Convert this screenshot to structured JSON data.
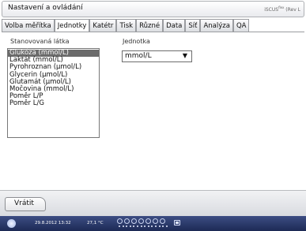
{
  "window": {
    "title": "Nastavení a ovládání",
    "brand": "iSCUS",
    "brand_sup": "flex",
    "brand_suffix": "(Rev L"
  },
  "tabs": [
    {
      "label": "Volba měřítka",
      "active": false
    },
    {
      "label": "Jednotky",
      "active": true
    },
    {
      "label": "Katétr",
      "active": false
    },
    {
      "label": "Tisk",
      "active": false
    },
    {
      "label": "Různé",
      "active": false
    },
    {
      "label": "Data",
      "active": false
    },
    {
      "label": "Síť",
      "active": false
    },
    {
      "label": "Analýza",
      "active": false
    },
    {
      "label": "QA",
      "active": false
    }
  ],
  "content": {
    "analyte_label": "Stanovovaná látka",
    "unit_label": "Jednotka",
    "analytes": [
      "Glukóza (mmol/L)",
      "Laktát (mmol/L)",
      "Pyrohroznan (μmol/L)",
      "Glycerin (μmol/L)",
      "Glutamát (μmol/L)",
      "Močovina (mmol/L)",
      "Poměr L/P",
      "Poměr L/G"
    ],
    "selected_index": 0,
    "unit_value": "mmol/L"
  },
  "bottom": {
    "back_label": "Vrátit"
  },
  "status": {
    "datetime": "29.8.2012 13:32",
    "temperature": "27,1 °C"
  }
}
